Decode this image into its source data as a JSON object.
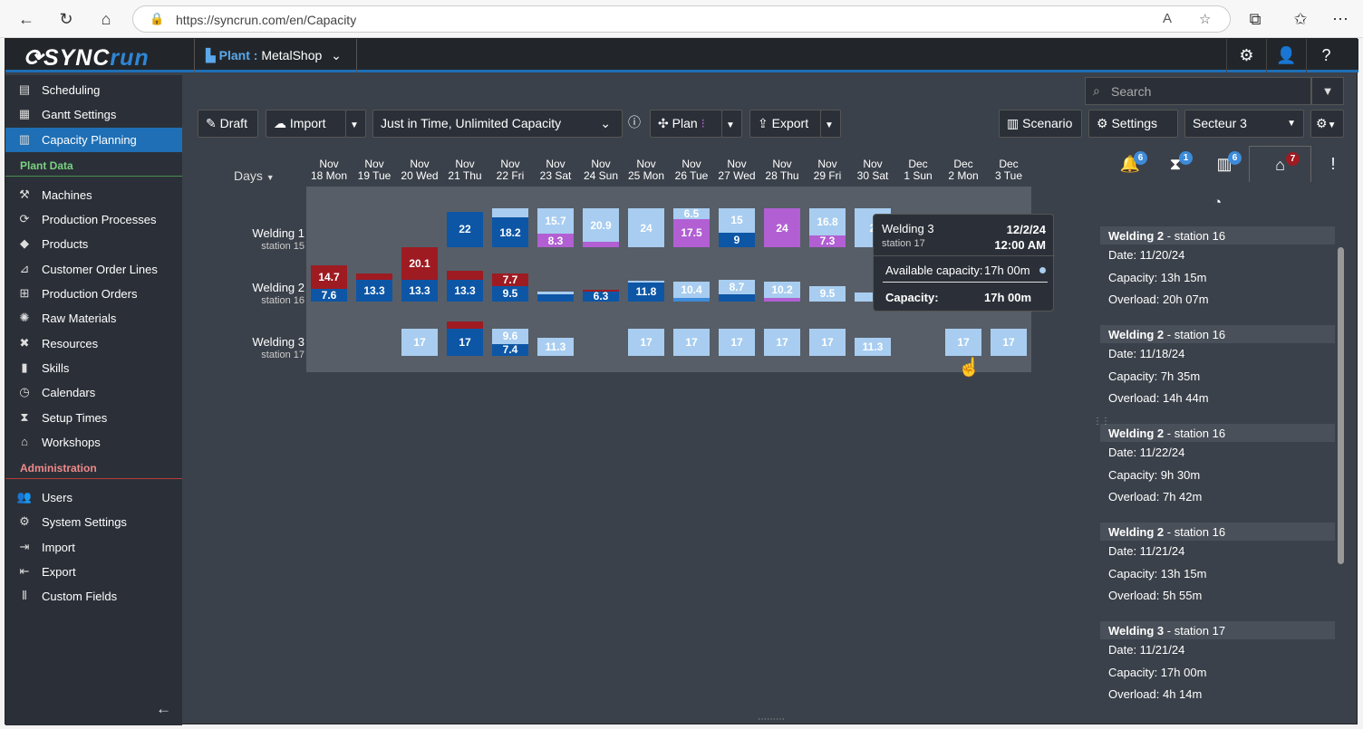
{
  "browser": {
    "url": "https://syncrun.com/en/Capacity",
    "back_icon": "back-arrow-icon",
    "reload_icon": "reload-icon",
    "home_icon": "home-icon"
  },
  "app": {
    "logo_a": "SYNC",
    "logo_b": "run",
    "plant_label": "Plant :",
    "plant_value": "MetalShop"
  },
  "sidebar": {
    "items": [
      "Scheduling",
      "Gantt Settings",
      "Capacity Planning"
    ],
    "plant_data_header": "Plant Data",
    "plant_items": [
      "Machines",
      "Production Processes",
      "Products",
      "Customer Order Lines",
      "Production Orders",
      "Raw Materials",
      "Resources",
      "Skills",
      "Calendars",
      "Setup Times",
      "Workshops"
    ],
    "admin_header": "Administration",
    "admin_items": [
      "Users",
      "System Settings",
      "Import",
      "Export",
      "Custom Fields"
    ]
  },
  "toolbar": {
    "draft": "Draft",
    "import": "Import",
    "strategy": "Just in Time, Unlimited Capacity",
    "plan": "Plan",
    "export": "Export",
    "scenario": "Scenario",
    "settings": "Settings",
    "sector": "Secteur 3",
    "search_placeholder": "Search"
  },
  "grid": {
    "days_label": "Days",
    "columns": [
      [
        "Nov",
        "18 Mon"
      ],
      [
        "Nov",
        "19 Tue"
      ],
      [
        "Nov",
        "20 Wed"
      ],
      [
        "Nov",
        "21 Thu"
      ],
      [
        "Nov",
        "22 Fri"
      ],
      [
        "Nov",
        "23 Sat"
      ],
      [
        "Nov",
        "24 Sun"
      ],
      [
        "Nov",
        "25 Mon"
      ],
      [
        "Nov",
        "26 Tue"
      ],
      [
        "Nov",
        "27 Wed"
      ],
      [
        "Nov",
        "28 Thu"
      ],
      [
        "Nov",
        "29 Fri"
      ],
      [
        "Nov",
        "30 Sat"
      ],
      [
        "Dec",
        "1 Sun"
      ],
      [
        "Dec",
        "2 Mon"
      ],
      [
        "Dec",
        "3 Tue"
      ]
    ],
    "rows": [
      {
        "name": "Welding 1",
        "station": "station 15"
      },
      {
        "name": "Welding 2",
        "station": "station 16"
      },
      {
        "name": "Welding 3",
        "station": "station 17"
      }
    ]
  },
  "chart_data": {
    "type": "bar",
    "title": "",
    "unit": "hours",
    "colors": {
      "available": "#a8cdf0",
      "scheduled": "#0d56a6",
      "mid": "#3d8bd9",
      "magenta": "#b15fd3",
      "overload": "#9e1b22"
    },
    "cells": [
      {
        "row": 0,
        "col": 3,
        "segs": [
          {
            "c": "scheduled",
            "h": 22,
            "label": "22"
          }
        ]
      },
      {
        "row": 0,
        "col": 4,
        "segs": [
          {
            "c": "available",
            "h": 5.8,
            "label": "5.8"
          },
          {
            "c": "scheduled",
            "h": 18.2,
            "label": "18.2"
          }
        ]
      },
      {
        "row": 0,
        "col": 5,
        "segs": [
          {
            "c": "available",
            "h": 15.7,
            "label": "15.7"
          },
          {
            "c": "magenta",
            "h": 8.3,
            "label": "8.3"
          }
        ]
      },
      {
        "row": 0,
        "col": 6,
        "segs": [
          {
            "c": "available",
            "h": 20.9,
            "label": "20.9"
          },
          {
            "c": "magenta",
            "h": 3.1,
            "label": ""
          }
        ]
      },
      {
        "row": 0,
        "col": 7,
        "segs": [
          {
            "c": "available",
            "h": 24,
            "label": "24"
          }
        ]
      },
      {
        "row": 0,
        "col": 8,
        "segs": [
          {
            "c": "available",
            "h": 6.5,
            "label": "6.5"
          },
          {
            "c": "magenta",
            "h": 17.5,
            "label": "17.5"
          }
        ]
      },
      {
        "row": 0,
        "col": 9,
        "segs": [
          {
            "c": "available",
            "h": 15,
            "label": "15"
          },
          {
            "c": "scheduled",
            "h": 9,
            "label": "9"
          }
        ]
      },
      {
        "row": 0,
        "col": 10,
        "segs": [
          {
            "c": "magenta",
            "h": 24,
            "label": "24"
          }
        ]
      },
      {
        "row": 0,
        "col": 11,
        "segs": [
          {
            "c": "available",
            "h": 16.8,
            "label": "16.8"
          },
          {
            "c": "magenta",
            "h": 7.3,
            "label": "7.3"
          }
        ]
      },
      {
        "row": 0,
        "col": 12,
        "segs": [
          {
            "c": "available",
            "h": 24,
            "label": "2"
          }
        ]
      },
      {
        "row": 1,
        "col": 0,
        "segs": [
          {
            "c": "overload",
            "h": 14.7,
            "label": "14.7"
          },
          {
            "c": "scheduled",
            "h": 7.6,
            "label": "7.6"
          }
        ]
      },
      {
        "row": 1,
        "col": 1,
        "segs": [
          {
            "c": "overload",
            "h": 3.9,
            "label": "3.9"
          },
          {
            "c": "scheduled",
            "h": 13.3,
            "label": "13.3"
          }
        ]
      },
      {
        "row": 1,
        "col": 2,
        "segs": [
          {
            "c": "overload",
            "h": 20.1,
            "label": "20.1"
          },
          {
            "c": "scheduled",
            "h": 13.3,
            "label": "13.3"
          }
        ]
      },
      {
        "row": 1,
        "col": 3,
        "segs": [
          {
            "c": "overload",
            "h": 5.9,
            "label": "5.9"
          },
          {
            "c": "scheduled",
            "h": 13.3,
            "label": "13.3"
          }
        ]
      },
      {
        "row": 1,
        "col": 4,
        "segs": [
          {
            "c": "overload",
            "h": 7.7,
            "label": "7.7"
          },
          {
            "c": "scheduled",
            "h": 9.5,
            "label": "9.5"
          }
        ]
      },
      {
        "row": 1,
        "col": 5,
        "segs": [
          {
            "c": "available",
            "h": 2,
            "label": ""
          },
          {
            "c": "scheduled",
            "h": 4.3,
            "label": "4.3"
          }
        ]
      },
      {
        "row": 1,
        "col": 6,
        "segs": [
          {
            "c": "overload",
            "h": 1,
            "label": ""
          },
          {
            "c": "scheduled",
            "h": 6.3,
            "label": "6.3"
          }
        ]
      },
      {
        "row": 1,
        "col": 7,
        "segs": [
          {
            "c": "available",
            "h": 1,
            "label": ""
          },
          {
            "c": "scheduled",
            "h": 11.8,
            "label": "11.8"
          }
        ]
      },
      {
        "row": 1,
        "col": 8,
        "segs": [
          {
            "c": "available",
            "h": 10.4,
            "label": "10.4"
          },
          {
            "c": "mid",
            "h": 2,
            "label": ""
          }
        ]
      },
      {
        "row": 1,
        "col": 9,
        "segs": [
          {
            "c": "available",
            "h": 8.7,
            "label": "8.7"
          },
          {
            "c": "scheduled",
            "h": 4.5,
            "label": "4.5"
          }
        ]
      },
      {
        "row": 1,
        "col": 10,
        "segs": [
          {
            "c": "available",
            "h": 10.2,
            "label": "10.2"
          },
          {
            "c": "magenta",
            "h": 2,
            "label": ""
          }
        ]
      },
      {
        "row": 1,
        "col": 11,
        "segs": [
          {
            "c": "available",
            "h": 9.5,
            "label": "9.5"
          }
        ]
      },
      {
        "row": 1,
        "col": 12,
        "segs": [
          {
            "c": "available",
            "h": 5,
            "label": "5."
          }
        ]
      },
      {
        "row": 2,
        "col": 2,
        "segs": [
          {
            "c": "available",
            "h": 17,
            "label": "17"
          }
        ]
      },
      {
        "row": 2,
        "col": 3,
        "segs": [
          {
            "c": "overload",
            "h": 4.2,
            "label": "4.2"
          },
          {
            "c": "scheduled",
            "h": 17,
            "label": "17"
          }
        ]
      },
      {
        "row": 2,
        "col": 4,
        "segs": [
          {
            "c": "available",
            "h": 9.6,
            "label": "9.6"
          },
          {
            "c": "scheduled",
            "h": 7.4,
            "label": "7.4"
          }
        ]
      },
      {
        "row": 2,
        "col": 5,
        "segs": [
          {
            "c": "available",
            "h": 11.3,
            "label": "11.3"
          }
        ]
      },
      {
        "row": 2,
        "col": 7,
        "segs": [
          {
            "c": "available",
            "h": 17,
            "label": "17"
          }
        ]
      },
      {
        "row": 2,
        "col": 8,
        "segs": [
          {
            "c": "available",
            "h": 17,
            "label": "17"
          }
        ]
      },
      {
        "row": 2,
        "col": 9,
        "segs": [
          {
            "c": "available",
            "h": 17,
            "label": "17"
          }
        ]
      },
      {
        "row": 2,
        "col": 10,
        "segs": [
          {
            "c": "available",
            "h": 17,
            "label": "17"
          }
        ]
      },
      {
        "row": 2,
        "col": 11,
        "segs": [
          {
            "c": "available",
            "h": 17,
            "label": "17"
          }
        ]
      },
      {
        "row": 2,
        "col": 12,
        "segs": [
          {
            "c": "available",
            "h": 11.3,
            "label": "11.3"
          }
        ]
      },
      {
        "row": 2,
        "col": 14,
        "segs": [
          {
            "c": "available",
            "h": 17,
            "label": "17"
          }
        ]
      },
      {
        "row": 2,
        "col": 15,
        "segs": [
          {
            "c": "available",
            "h": 17,
            "label": "17"
          }
        ]
      }
    ]
  },
  "tooltip": {
    "machine": "Welding 3",
    "station": "station 17",
    "date": "12/2/24",
    "time": "12:00 AM",
    "available_label": "Available capacity:",
    "available_value": "17h 00m",
    "capacity_label": "Capacity:",
    "capacity_value": "17h 00m"
  },
  "right_panel": {
    "badges": {
      "bell": "6",
      "hourglass": "1",
      "chart": "6",
      "warehouse": "7"
    },
    "overloads": [
      {
        "title_a": "Welding 2",
        "title_b": " - station 16",
        "date": "Date: 11/20/24",
        "capacity": "Capacity: 13h 15m",
        "overload": "Overload: 20h 07m"
      },
      {
        "title_a": "Welding 2",
        "title_b": " - station 16",
        "date": "Date: 11/18/24",
        "capacity": "Capacity: 7h 35m",
        "overload": "Overload: 14h 44m"
      },
      {
        "title_a": "Welding 2",
        "title_b": " - station 16",
        "date": "Date: 11/22/24",
        "capacity": "Capacity: 9h 30m",
        "overload": "Overload: 7h 42m"
      },
      {
        "title_a": "Welding 2",
        "title_b": " - station 16",
        "date": "Date: 11/21/24",
        "capacity": "Capacity: 13h 15m",
        "overload": "Overload: 5h 55m"
      },
      {
        "title_a": "Welding 3",
        "title_b": " - station 17",
        "date": "Date: 11/21/24",
        "capacity": "Capacity: 17h 00m",
        "overload": "Overload: 4h 14m"
      }
    ]
  }
}
